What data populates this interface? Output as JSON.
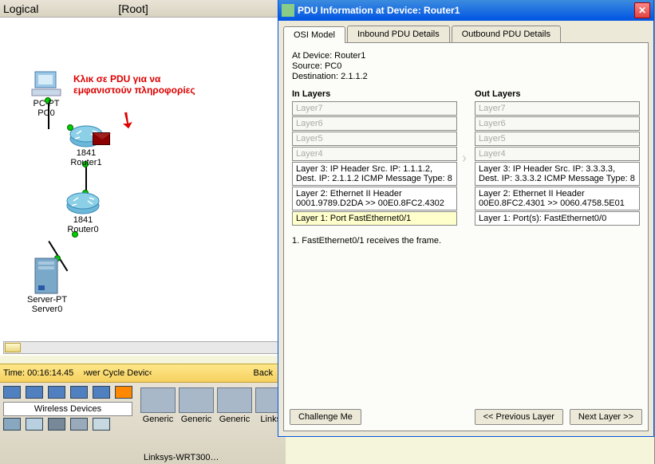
{
  "workspace": {
    "view_label": "Logical",
    "root_label": "[Root]",
    "time_label": "Time: 00:16:14.45",
    "cycle_label": "›wer Cycle Devic‹",
    "back_label": "Back"
  },
  "annotation": {
    "line1": "Κλικ σε PDU για να",
    "line2": "εμφανιστούν πληροφορίες"
  },
  "devices": {
    "pc": {
      "type": "PC-PT",
      "name": "PC0"
    },
    "router1": {
      "type": "1841",
      "name": "Router1"
    },
    "router0": {
      "type": "1841",
      "name": "Router0"
    },
    "server": {
      "type": "Server-PT",
      "name": "Server0"
    }
  },
  "device_panel": {
    "category_label": "Wireless Devices",
    "generic_label": "Generic",
    "linksys_label": "Linksy",
    "selected_device": "Linksys-WRT300…"
  },
  "pdu": {
    "title": "PDU Information at Device: Router1",
    "tabs": {
      "osi": "OSI Model",
      "inbound": "Inbound PDU Details",
      "outbound": "Outbound PDU Details"
    },
    "info": {
      "at_device": "At Device: Router1",
      "source": "Source: PC0",
      "dest": "Destination: 2.1.1.2"
    },
    "in_layers_title": "In Layers",
    "out_layers_title": "Out Layers",
    "in_layers": {
      "l7": "Layer7",
      "l6": "Layer6",
      "l5": "Layer5",
      "l4": "Layer4",
      "l3": "Layer 3: IP Header Src. IP: 1.1.1.2, Dest. IP: 2.1.1.2 ICMP Message Type: 8",
      "l2": "Layer 2: Ethernet II Header 0001.9789.D2DA >> 00E0.8FC2.4302",
      "l1": "Layer 1: Port FastEthernet0/1"
    },
    "out_layers": {
      "l7": "Layer7",
      "l6": "Layer6",
      "l5": "Layer5",
      "l4": "Layer4",
      "l3": "Layer 3: IP Header Src. IP: 3.3.3.3, Dest. IP: 3.3.3.2 ICMP Message Type: 8",
      "l2": "Layer 2: Ethernet II Header 00E0.8FC2.4301 >> 0060.4758.5E01",
      "l1": "Layer 1: Port(s): FastEthernet0/0"
    },
    "explanation": "1. FastEthernet0/1 receives the frame.",
    "buttons": {
      "challenge": "Challenge Me",
      "prev": "<< Previous Layer",
      "next": "Next Layer >>"
    }
  }
}
